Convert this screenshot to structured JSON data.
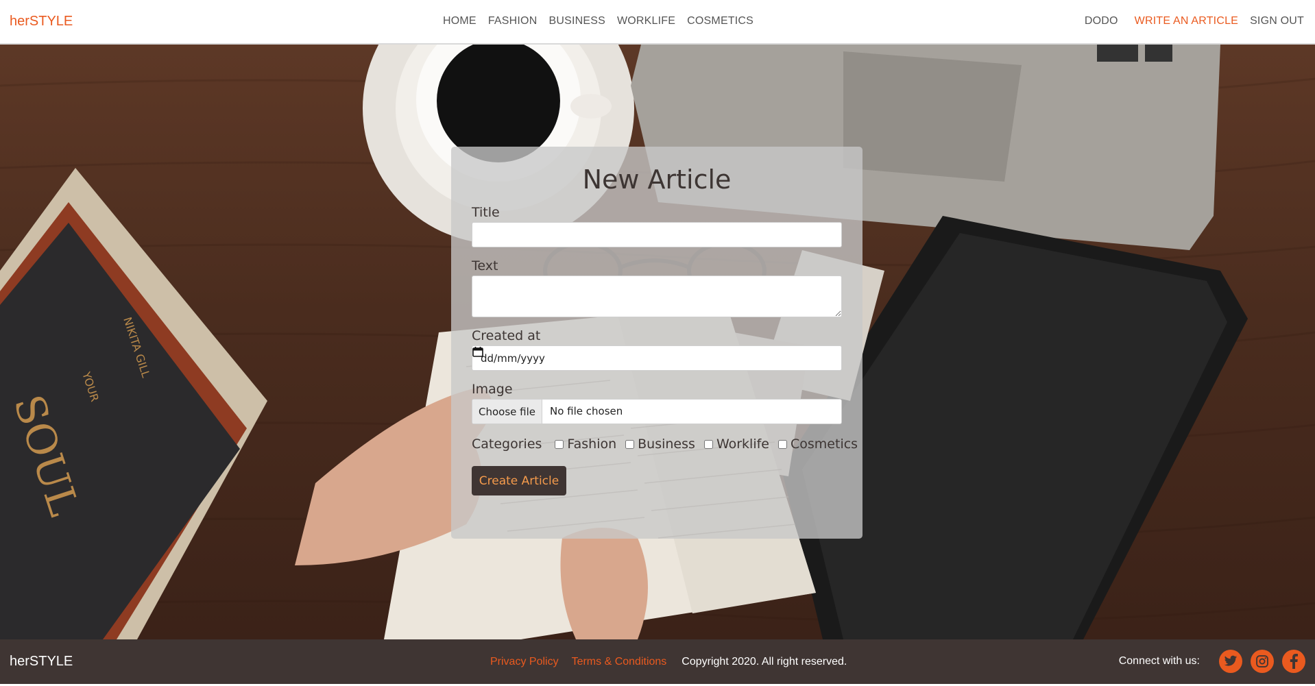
{
  "navbar": {
    "brand": "herSTYLE",
    "links": [
      "HOME",
      "FASHION",
      "BUSINESS",
      "WORKLIFE",
      "COSMETICS"
    ],
    "user": "DODO",
    "write_article": "WRITE AN ARTICLE",
    "sign_out": "SIGN OUT"
  },
  "form": {
    "heading": "New Article",
    "title_label": "Title",
    "title_value": "",
    "text_label": "Text",
    "text_value": "",
    "created_label": "Created at",
    "date_placeholder": "dd/mm/yyyy",
    "image_label": "Image",
    "file_button": "Choose file",
    "file_status": "No file chosen",
    "categories_label": "Categories",
    "categories": [
      "Fashion",
      "Business",
      "Worklife",
      "Cosmetics"
    ],
    "submit": "Create Article"
  },
  "footer": {
    "brand": "herSTYLE",
    "privacy": "Privacy Policy",
    "terms": "Terms & Conditions",
    "copyright": "Copyright 2020. All right reserved.",
    "connect": "Connect with us:",
    "social": [
      "twitter-icon",
      "instagram-icon",
      "facebook-icon"
    ]
  },
  "colors": {
    "accent": "#ea5a1f",
    "footer_bg": "#3f3533",
    "button_text": "#f59b4c"
  }
}
